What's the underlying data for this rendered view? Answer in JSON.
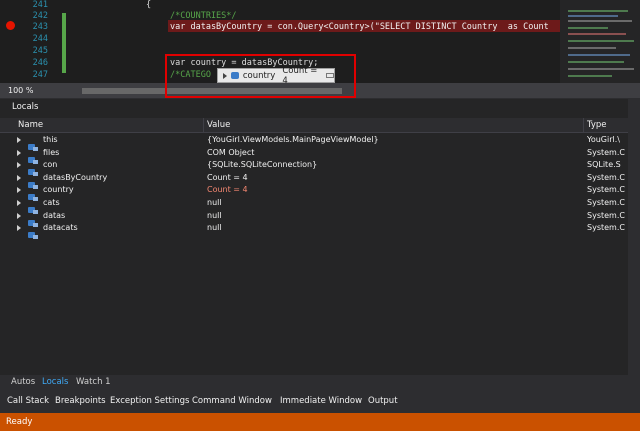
{
  "editor": {
    "line_numbers": [
      "241",
      "242",
      "243",
      "244",
      "245",
      "246",
      "247"
    ],
    "lines": [
      {
        "text": "{",
        "color": "#dcdcdc"
      },
      {
        "text": "/*COUNTRIES*/",
        "color": "#57a64a"
      },
      {
        "text": "var datasByCountry = con.Query<Country>(\"SELECT DISTINCT Country  as Count",
        "color": "#f1f1f1"
      },
      {
        "text": "",
        "color": "#dcdcdc"
      },
      {
        "text": "",
        "color": "#dcdcdc"
      },
      {
        "text": "var country = datasByCountry;",
        "color": "#dcdcdc"
      },
      {
        "text": "/*CATEGO",
        "color": "#57a64a"
      }
    ],
    "zoom": "100 %"
  },
  "datatip": {
    "name": "country",
    "value": "Count = 4"
  },
  "locals": {
    "title": "Locals",
    "columns": {
      "name": "Name",
      "value": "Value",
      "type": "Type"
    },
    "rows": [
      {
        "name": "this",
        "value": "{YouGirl.ViewModels.MainPageViewModel}",
        "type": "YouGirl.\\",
        "changed": false
      },
      {
        "name": "files",
        "value": "COM Object",
        "type": "System.C",
        "changed": false
      },
      {
        "name": "con",
        "value": "{SQLite.SQLiteConnection}",
        "type": "SQLite.S",
        "changed": false
      },
      {
        "name": "datasByCountry",
        "value": "Count = 4",
        "type": "System.C",
        "changed": false
      },
      {
        "name": "country",
        "value": "Count = 4",
        "type": "System.C",
        "changed": true
      },
      {
        "name": "cats",
        "value": "null",
        "type": "System.C",
        "changed": false
      },
      {
        "name": "datas",
        "value": "null",
        "type": "System.C",
        "changed": false
      },
      {
        "name": "datacats",
        "value": "null",
        "type": "System.C",
        "changed": false
      }
    ]
  },
  "debug_tabs": {
    "autos": "Autos",
    "locals": "Locals",
    "watch1": "Watch 1"
  },
  "tool_tabs": {
    "call_stack": "Call Stack",
    "breakpoints": "Breakpoints",
    "exception_settings": "Exception Settings",
    "command_window": "Command Window",
    "immediate_window": "Immediate Window",
    "output": "Output"
  },
  "status": {
    "text": "Ready"
  },
  "colors": {
    "accent": "#007acc",
    "status_bar": "#ca5100",
    "changed_value": "#f48771"
  }
}
